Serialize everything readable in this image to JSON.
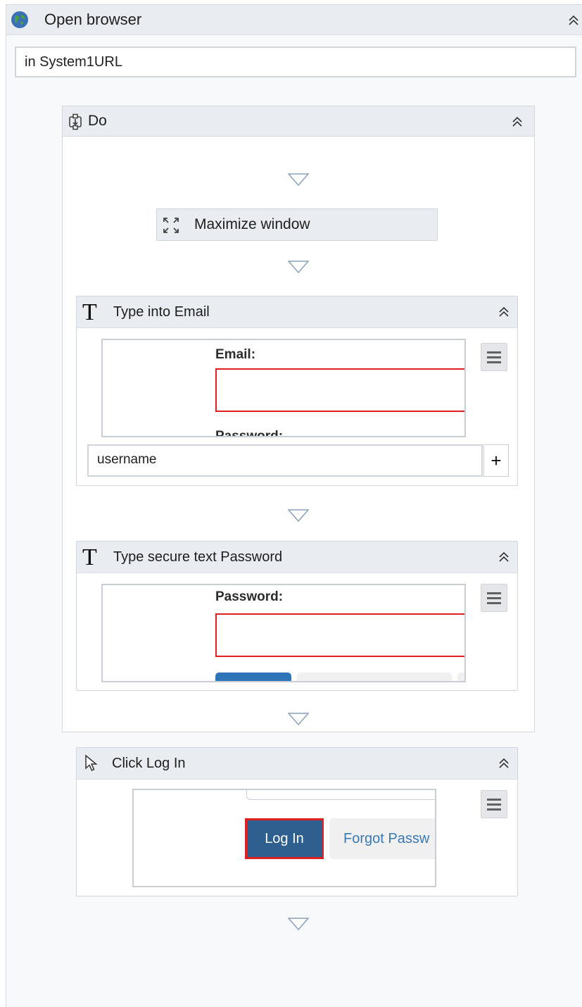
{
  "open_browser": {
    "title": "Open browser",
    "url_field": "in System1URL"
  },
  "do_sequence": {
    "title": "Do"
  },
  "maximize": {
    "title": "Maximize window"
  },
  "type_email": {
    "title": "Type into Email",
    "preview_label": "Email:",
    "preview_cut_label": "Password:",
    "value": "username",
    "add_label": "+"
  },
  "type_password": {
    "title": "Type secure text Password",
    "preview_label": "Password:"
  },
  "click_login": {
    "title": "Click Log In",
    "login_button": "Log In",
    "forgot_link": "Forgot Passw"
  },
  "colors": {
    "header_bg": "#e9ecf0",
    "highlight_red": "#e02020",
    "login_blue": "#2e5f8f",
    "link_blue": "#3a78b5"
  },
  "icons": {
    "browser": "globe-icon",
    "sequence": "sequence-icon",
    "maximize": "maximize-icon",
    "type": "type-text-icon",
    "click": "cursor-icon",
    "collapse": "double-chevron-up-icon",
    "arrow": "drop-arrow-icon",
    "menu": "hamburger-icon"
  }
}
